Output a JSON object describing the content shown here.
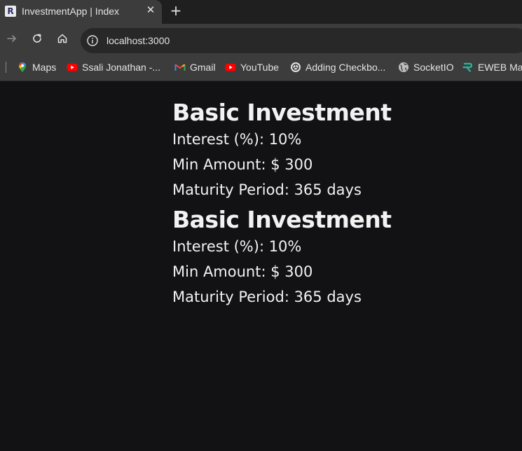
{
  "tab": {
    "favicon_letter": "R",
    "title": "InvestmentApp | Index",
    "close_glyph": "✕",
    "new_tab_glyph": "+"
  },
  "toolbar": {
    "url": "localhost:3000"
  },
  "bookmarks": [
    {
      "label": "Maps",
      "icon": "maps-pin-icon"
    },
    {
      "label": "Ssali Jonathan -...",
      "icon": "youtube-icon"
    },
    {
      "label": "Gmail",
      "icon": "gmail-icon"
    },
    {
      "label": "YouTube",
      "icon": "youtube-icon"
    },
    {
      "label": "Adding Checkbo...",
      "icon": "openai-icon"
    },
    {
      "label": "SocketIO",
      "icon": "globe-icon"
    },
    {
      "label": "EWEB Ma",
      "icon": "eweb-icon"
    }
  ],
  "plans": [
    {
      "name": "Basic Investment",
      "interest": "Interest (%): 10%",
      "min_amount": "Min Amount: $ 300",
      "maturity": "Maturity Period: 365 days"
    },
    {
      "name": "Basic Investment",
      "interest": "Interest (%): 10%",
      "min_amount": "Min Amount: $ 300",
      "maturity": "Maturity Period: 365 days"
    }
  ],
  "colors": {
    "page_background": "#121214",
    "chrome_background": "#3c3c3c",
    "tabstrip_background": "#1f1f1f",
    "text": "#f2f2f2"
  }
}
